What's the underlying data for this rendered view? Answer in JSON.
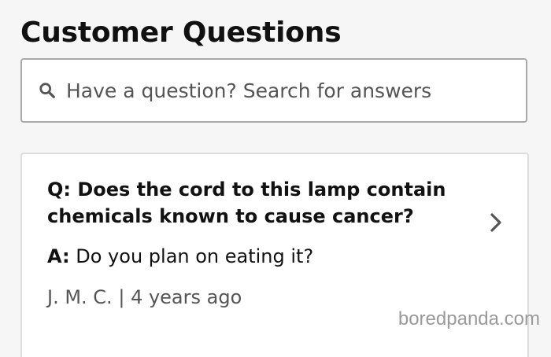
{
  "section": {
    "title": "Customer Questions"
  },
  "search": {
    "placeholder": "Have a question? Search for answers",
    "icon": "search-icon"
  },
  "qa_item": {
    "question": "Q: Does the cord to this lamp contain chemicals known to cause cancer?",
    "answer_prefix": "A:",
    "answer_text": "Do you plan on eating it?",
    "author": "J. M. C.",
    "separator": "|",
    "time_ago": "4 years ago",
    "chevron_icon": "chevron-right-icon"
  },
  "watermark": {
    "text": "boredpanda.com"
  },
  "colors": {
    "background": "#f6f6f6",
    "surface": "#ffffff",
    "text_primary": "#111111",
    "text_secondary": "#555555",
    "border": "#a9a9a9"
  }
}
